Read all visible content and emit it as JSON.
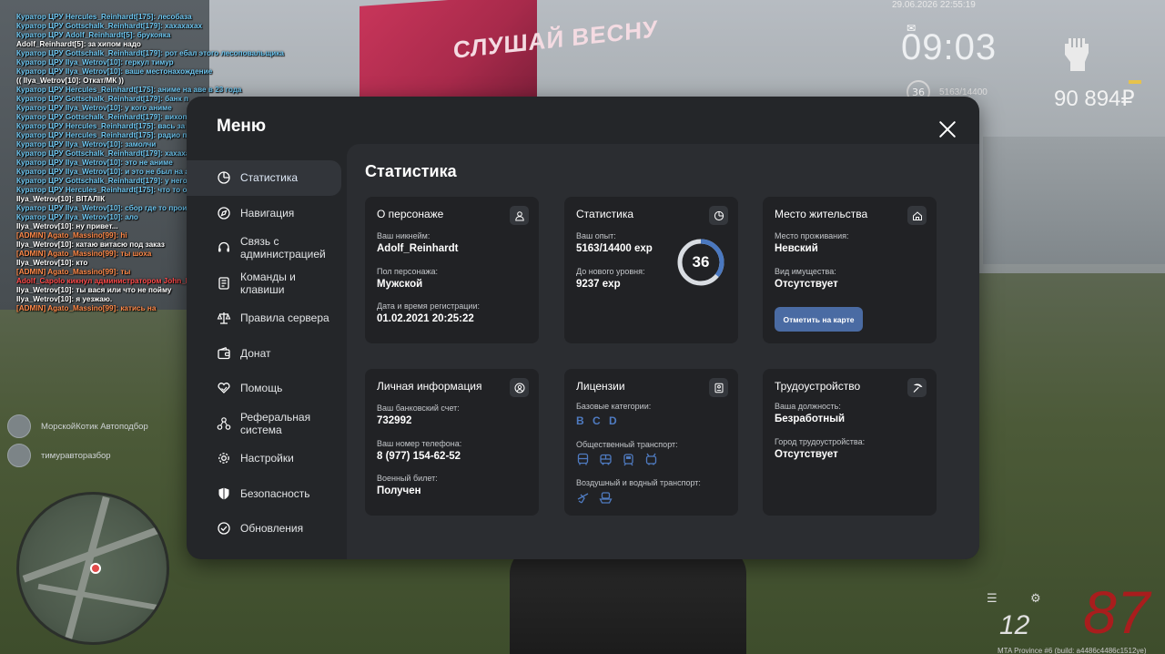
{
  "background": {
    "billboard_text": "СЛУШАЙ ВЕСНУ"
  },
  "chat": [
    {
      "text": "Куратор ЦРУ Hercules_Reinhardt[175]: лесобаза",
      "color": "#6ec6f0"
    },
    {
      "text": "Куратор ЦРУ Gottschalk_Reinhardt[179]: хахахахах",
      "color": "#6ec6f0"
    },
    {
      "text": "Куратор ЦРУ Adolf_Reinhardt[5]: брукояка",
      "color": "#6ec6f0"
    },
    {
      "text": "Adolf_Reinhardt[5]: за хипом надо",
      "color": "#ffffff"
    },
    {
      "text": "Куратор ЦРУ Gottschalk_Reinhardt[179]: рот ебал этого лесоповальщика",
      "color": "#6ec6f0"
    },
    {
      "text": "Куратор ЦРУ Ilya_Wetrov[10]: геркул тимур",
      "color": "#6ec6f0"
    },
    {
      "text": "Куратор ЦРУ Ilya_Wetrov[10]: ваше местонахождение",
      "color": "#6ec6f0"
    },
    {
      "text": "(( Ilya_Wetrov[10]: Откат/МК ))",
      "color": "#ffffff"
    },
    {
      "text": "Куратор ЦРУ Hercules_Reinhardt[175]: аниме на аве в 23 года",
      "color": "#6ec6f0"
    },
    {
      "text": "Куратор ЦРУ Gottschalk_Reinhardt[179]: банк п",
      "color": "#6ec6f0"
    },
    {
      "text": "Куратор ЦРУ Ilya_Wetrov[10]: у кого аниме",
      "color": "#6ec6f0"
    },
    {
      "text": "Куратор ЦРУ Gottschalk_Reinhardt[179]: вихоп",
      "color": "#6ec6f0"
    },
    {
      "text": "Куратор ЦРУ Hercules_Reinhardt[175]: вась за тобой тожк",
      "color": "#6ec6f0"
    },
    {
      "text": "Куратор ЦРУ Hercules_Reinhardt[175]: радио провинц",
      "color": "#6ec6f0"
    },
    {
      "text": "Куратор ЦРУ Ilya_Wetrov[10]: замолчи",
      "color": "#6ec6f0"
    },
    {
      "text": "Куратор ЦРУ Gottschalk_Reinhardt[179]: хахаха",
      "color": "#6ec6f0"
    },
    {
      "text": "Куратор ЦРУ Ilya_Wetrov[10]: это не аниме",
      "color": "#6ec6f0"
    },
    {
      "text": "Куратор ЦРУ Ilya_Wetrov[10]: и это не был на анекак у Питате А...",
      "color": "#6ec6f0"
    },
    {
      "text": "Куратор ЦРУ Gottschalk_Reinhardt[179]: у него позза ваш...",
      "color": "#6ec6f0"
    },
    {
      "text": "Куратор ЦРУ Hercules_Reinhardt[175]: что то опивкое...",
      "color": "#6ec6f0"
    },
    {
      "text": "Ilya_Wetrov[10]: ВІТАЛІК",
      "color": "#ffffff"
    },
    {
      "text": "Куратор ЦРУ Ilya_Wetrov[10]: сбор где то производим или мотопроверяло",
      "color": "#6ec6f0"
    },
    {
      "text": "Куратор ЦРУ Ilya_Wetrov[10]: ало",
      "color": "#6ec6f0"
    },
    {
      "text": "Ilya_Wetrov[10]: ну привет...",
      "color": "#ffffff"
    },
    {
      "text": "[ADMIN] Agato_Massino[99]: hi",
      "color": "#ff8a4a"
    },
    {
      "text": "Ilya_Wetrov[10]: катаю витасю под заказ",
      "color": "#ffffff"
    },
    {
      "text": "[ADMIN] Agato_Massino[99]: ты шоха",
      "color": "#ff8a4a"
    },
    {
      "text": "Ilya_Wetrov[10]: кто",
      "color": "#ffffff"
    },
    {
      "text": "[ADMIN] Agato_Massino[99]: ты",
      "color": "#ff8a4a"
    },
    {
      "text": "Adolf_Capolo кикнул администратором John_Heller (AFK без вызова)",
      "color": "#ff4a4a"
    },
    {
      "text": "Ilya_Wetrov[10]: ты вася или что не пойму",
      "color": "#ffffff"
    },
    {
      "text": "Ilya_Wetrov[10]: я уезжаю.",
      "color": "#ffffff"
    },
    {
      "text": "[ADMIN] Agato_Massino[99]: катись на",
      "color": "#ff8a4a"
    }
  ],
  "hud": {
    "datetime": "29.06.2026 22:55:19",
    "clock": "09:03",
    "level": "36",
    "exp": "5163/14400",
    "money": "90 894₽"
  },
  "players": [
    {
      "name": "МорскойКотик Автоподбор"
    },
    {
      "name": "тимуравторазбор"
    }
  ],
  "speedo": {
    "speed": "87",
    "gear": "12",
    "footer": "MTA Province #6 (build: a4486c4486c1512ye)"
  },
  "menu": {
    "title": "Меню",
    "nav": [
      {
        "label": "Статистика",
        "icon": "stats-icon",
        "active": true
      },
      {
        "label": "Навигация",
        "icon": "compass-icon"
      },
      {
        "label": "Связь с администрацией",
        "icon": "headset-icon"
      },
      {
        "label": "Команды и клавиши",
        "icon": "keyboard-icon"
      },
      {
        "label": "Правила сервера",
        "icon": "scales-icon"
      },
      {
        "label": "Донат",
        "icon": "wallet-icon"
      },
      {
        "label": "Помощь",
        "icon": "heart-hand-icon"
      },
      {
        "label": "Реферальная система",
        "icon": "referral-icon"
      },
      {
        "label": "Настройки",
        "icon": "gear-icon"
      },
      {
        "label": "Безопасность",
        "icon": "shield-icon"
      },
      {
        "label": "Обновления",
        "icon": "update-icon"
      }
    ],
    "content_title": "Статистика",
    "character": {
      "title": "О персонаже",
      "nickname_label": "Ваш никнейм:",
      "nickname": "Adolf_Reinhardt",
      "gender_label": "Пол персонажа:",
      "gender": "Мужской",
      "reg_label": "Дата и время регистрации:",
      "reg": "01.02.2021 20:25:22"
    },
    "stats": {
      "title": "Статистика",
      "exp_label": "Ваш опыт:",
      "exp": "5163/14400 exp",
      "next_label": "До нового уровня:",
      "next": "9237 exp",
      "level": "36",
      "progress": 0.3585
    },
    "residence": {
      "title": "Место жительства",
      "place_label": "Место проживания:",
      "place": "Невский",
      "property_label": "Вид имущества:",
      "property": "Отсутствует",
      "map_button": "Отметить на карте"
    },
    "personal": {
      "title": "Личная информация",
      "bank_label": "Ваш банковский счет:",
      "bank": "732992",
      "phone_label": "Ваш номер телефона:",
      "phone": "8 (977) 154-62-52",
      "military_label": "Военный билет:",
      "military": "Получен"
    },
    "licenses": {
      "title": "Лицензии",
      "basic_label": "Базовые категории:",
      "basic": [
        "B",
        "C",
        "D"
      ],
      "public_label": "Общественный транспорт:",
      "air_label": "Воздушный и водный транспорт:"
    },
    "employment": {
      "title": "Трудоустройство",
      "position_label": "Ваша должность:",
      "position": "Безработный",
      "city_label": "Город трудоустройства:",
      "city": "Отсутствует"
    }
  }
}
